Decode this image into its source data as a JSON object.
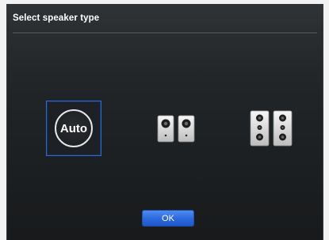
{
  "dialog": {
    "title": "Select speaker type",
    "ok_label": "OK"
  },
  "options": [
    {
      "name": "auto",
      "label": "Auto",
      "selected": true,
      "icon": "auto-icon"
    },
    {
      "name": "2-speakers",
      "selected": false,
      "icon": "two-speaker-icon"
    },
    {
      "name": "4-speakers",
      "selected": false,
      "icon": "four-speaker-icon"
    }
  ],
  "colors": {
    "selection_border": "#2e6bd1",
    "ok_button": "#2d6ae0",
    "background": "#1c1f21"
  }
}
